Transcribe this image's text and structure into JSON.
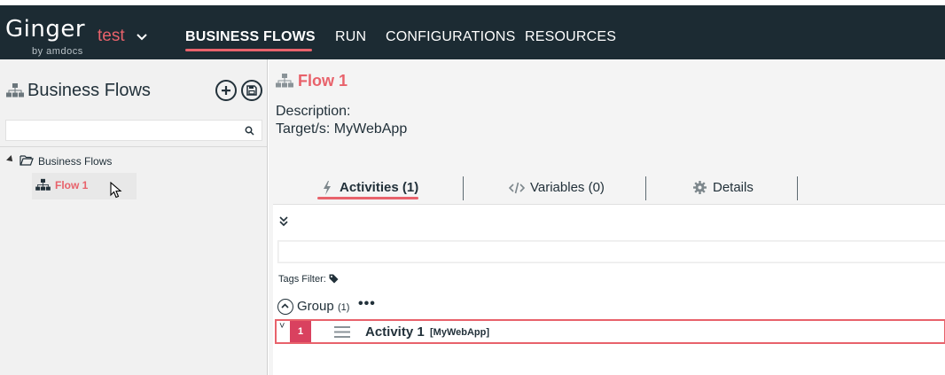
{
  "app": {
    "logo": "Ginger",
    "logo_sub": "by amdocs",
    "solution": "test"
  },
  "nav": {
    "items": [
      {
        "label": "BUSINESS FLOWS"
      },
      {
        "label": "RUN"
      },
      {
        "label": "CONFIGURATIONS"
      },
      {
        "label": "RESOURCES"
      }
    ]
  },
  "left_panel": {
    "title": "Business Flows",
    "search_placeholder": "",
    "tree": {
      "root": "Business Flows",
      "children": [
        {
          "label": "Flow 1"
        }
      ]
    }
  },
  "main": {
    "flow_title": "Flow 1",
    "description": "Description:",
    "targets": "Target/s: MyWebApp",
    "tabs": [
      {
        "label": "Activities (1)"
      },
      {
        "label": "Variables (0)"
      },
      {
        "label": "Details"
      }
    ],
    "tags_filter": "Tags Filter:",
    "group": {
      "label": "Group",
      "count": "(1)",
      "more": "•••"
    },
    "activity": {
      "toggle": "˅",
      "number": "1",
      "name": "Activity 1",
      "target": "[MyWebApp]"
    }
  },
  "colors": {
    "topbar": "#1c2b33",
    "accent": "#e8626b",
    "activity_badge": "#d9415f"
  }
}
